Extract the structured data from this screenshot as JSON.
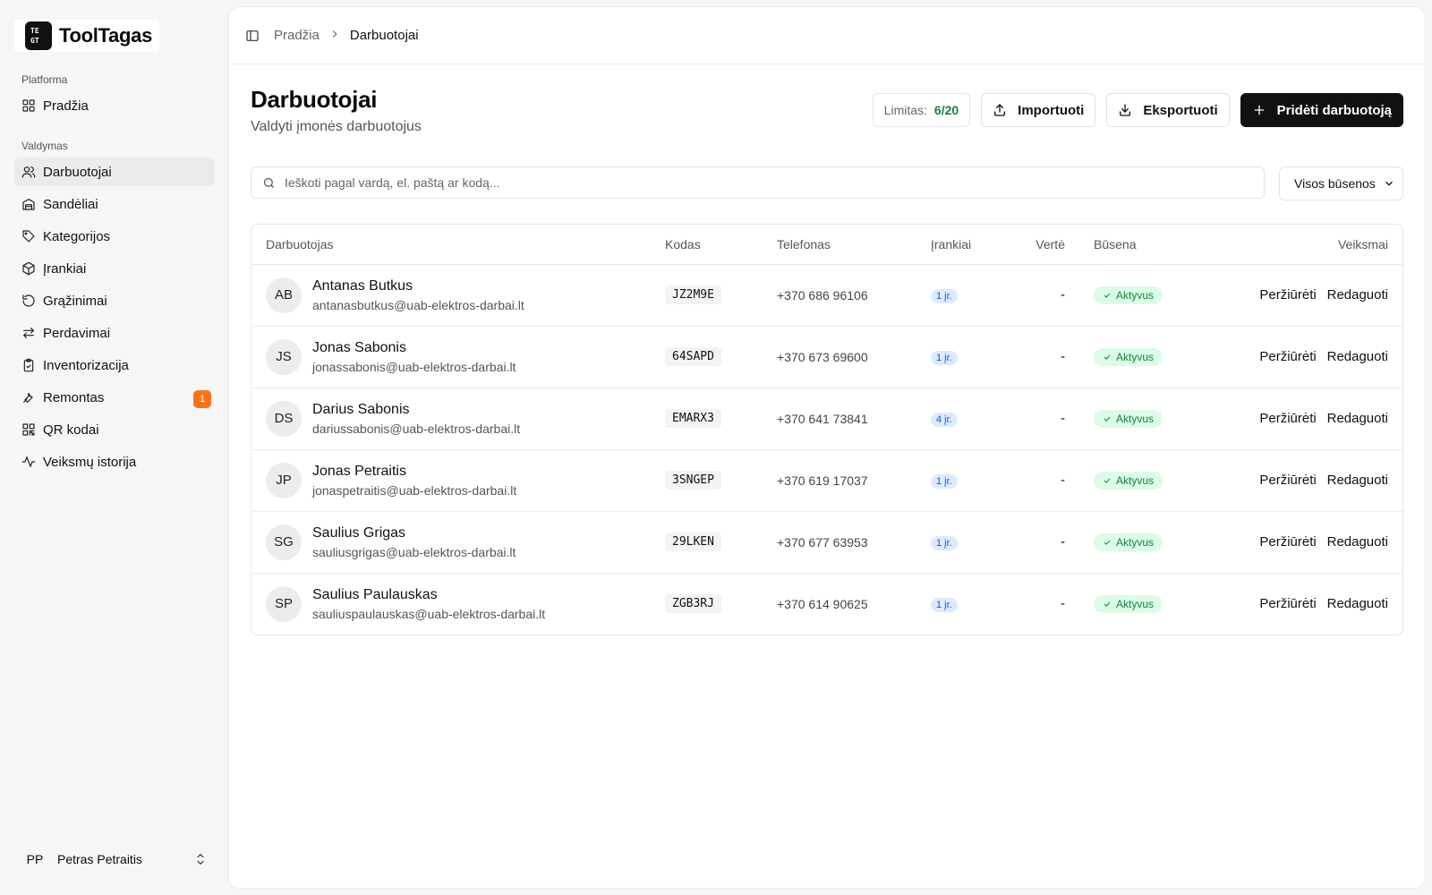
{
  "brand": {
    "logo_text": [
      "TE",
      "GT"
    ],
    "name": "ToolTagas"
  },
  "sidebar": {
    "section_platform": "Platforma",
    "section_manage": "Valdymas",
    "platform_items": [
      {
        "label": "Pradžia",
        "icon": "grid-icon"
      }
    ],
    "manage_items": [
      {
        "label": "Darbuotojai",
        "icon": "users-icon",
        "active": true
      },
      {
        "label": "Sandėliai",
        "icon": "warehouse-icon"
      },
      {
        "label": "Kategorijos",
        "icon": "tag-icon"
      },
      {
        "label": "Įrankiai",
        "icon": "box-icon"
      },
      {
        "label": "Grąžinimai",
        "icon": "return-icon"
      },
      {
        "label": "Perdavimai",
        "icon": "transfer-icon"
      },
      {
        "label": "Inventorizacija",
        "icon": "clipboard-icon"
      },
      {
        "label": "Remontas",
        "icon": "wrench-icon",
        "badge": "1"
      },
      {
        "label": "QR kodai",
        "icon": "qr-icon"
      },
      {
        "label": "Veiksmų istorija",
        "icon": "activity-icon"
      }
    ],
    "user": {
      "initials": "PP",
      "name": "Petras Petraitis"
    }
  },
  "breadcrumb": {
    "home": "Pradžia",
    "current": "Darbuotojai"
  },
  "page": {
    "title": "Darbuotojai",
    "subtitle": "Valdyti įmonės darbuotojus",
    "limit_label": "Limitas:",
    "limit_value": "6/20",
    "import_label": "Importuoti",
    "export_label": "Eksportuoti",
    "add_label": "Pridėti darbuotoją"
  },
  "search": {
    "placeholder": "Ieškoti pagal vardą, el. paštą ar kodą..."
  },
  "status_filter": {
    "selected": "Visos būsenos"
  },
  "table": {
    "headers": {
      "employee": "Darbuotojas",
      "code": "Kodas",
      "phone": "Telefonas",
      "tools": "Įrankiai",
      "value": "Vertė",
      "status": "Būsena",
      "actions": "Veiksmai"
    },
    "view_label": "Peržiūrėti",
    "edit_label": "Redaguoti",
    "rows": [
      {
        "initials": "AB",
        "name": "Antanas Butkus",
        "email": "antanasbutkus@uab-elektros-darbai.lt",
        "code": "JZ2M9E",
        "phone": "+370 686 96106",
        "tools": "1 įr.",
        "value": "-",
        "status": "Aktyvus"
      },
      {
        "initials": "JS",
        "name": "Jonas Sabonis",
        "email": "jonassabonis@uab-elektros-darbai.lt",
        "code": "64SAPD",
        "phone": "+370 673 69600",
        "tools": "1 įr.",
        "value": "-",
        "status": "Aktyvus"
      },
      {
        "initials": "DS",
        "name": "Darius Sabonis",
        "email": "dariussabonis@uab-elektros-darbai.lt",
        "code": "EMARX3",
        "phone": "+370 641 73841",
        "tools": "4 įr.",
        "value": "-",
        "status": "Aktyvus"
      },
      {
        "initials": "JP",
        "name": "Jonas Petraitis",
        "email": "jonaspetraitis@uab-elektros-darbai.lt",
        "code": "3SNGEP",
        "phone": "+370 619 17037",
        "tools": "1 įr.",
        "value": "-",
        "status": "Aktyvus"
      },
      {
        "initials": "SG",
        "name": "Saulius Grigas",
        "email": "sauliusgrigas@uab-elektros-darbai.lt",
        "code": "29LKEN",
        "phone": "+370 677 63953",
        "tools": "1 įr.",
        "value": "-",
        "status": "Aktyvus"
      },
      {
        "initials": "SP",
        "name": "Saulius Paulauskas",
        "email": "sauliuspaulauskas@uab-elektros-darbai.lt",
        "code": "ZGB3RJ",
        "phone": "+370 614 90625",
        "tools": "1 įr.",
        "value": "-",
        "status": "Aktyvus"
      }
    ]
  },
  "colors": {
    "accent": "#111111",
    "badge": "#f97316",
    "active_status": "#15803d",
    "tools_badge": "#dbeafe"
  }
}
